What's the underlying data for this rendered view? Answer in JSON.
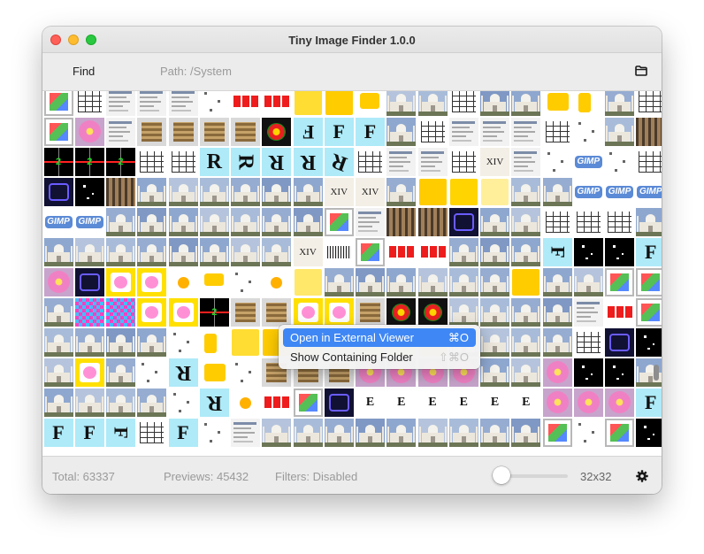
{
  "window": {
    "title": "Tiny Image Finder 1.0.0"
  },
  "toolbar": {
    "find_label": "Find",
    "path_text": "Path: /System",
    "folder_icon": "folder-icon"
  },
  "status": {
    "total_text": "Total: 63337",
    "previews_text": "Previews: 45432",
    "filters_text": "Filters: Disabled",
    "size_label": "32x32",
    "slider_fraction": 0.0,
    "gear_icon": "gear-icon"
  },
  "scroll": {
    "fraction": 0.75
  },
  "context_menu": {
    "items": [
      {
        "label": "Open in External Viewer",
        "shortcut": "⌘O",
        "active": true
      },
      {
        "label": "Show Containing Folder",
        "shortcut": "⇧⌘O",
        "active": false
      }
    ]
  },
  "thumb_text": {
    "r": "R",
    "f": "F",
    "e": "E",
    "gimp": "GIMP",
    "xiv": "XIV"
  },
  "colors": {
    "accent": "#3f87f4",
    "close": "#fe5f57",
    "minimize": "#febc2e",
    "maximize": "#28c840"
  }
}
